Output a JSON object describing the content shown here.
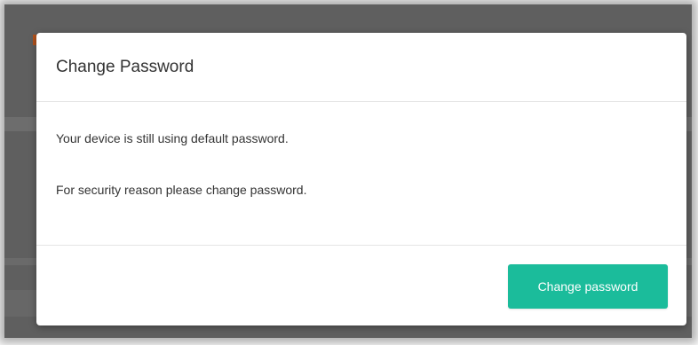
{
  "colors": {
    "overlay": "#5f5f5f",
    "accent_bg": "#b2521c",
    "primary_button": "#1bbc9b",
    "text": "#333333",
    "divider": "#e5e5e5"
  },
  "dialog": {
    "title": "Change Password",
    "messages": [
      "Your device is still using default password.",
      "For security reason please change password."
    ],
    "primary_button_label": "Change password"
  }
}
